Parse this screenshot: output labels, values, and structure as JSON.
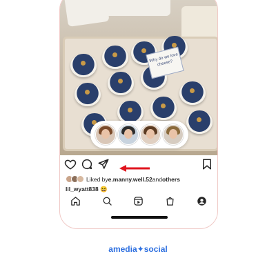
{
  "post": {
    "image_alt": "cheese display photo",
    "card_text": "Why do we love cheese?"
  },
  "share_sheet": {
    "friends": [
      {
        "name": "friend-1",
        "hair": "#7a4a2a",
        "bg": "#d9c7b8"
      },
      {
        "name": "friend-2",
        "hair": "#2c2c2c",
        "bg": "#c8d3de"
      },
      {
        "name": "friend-3",
        "hair": "#5b3b22",
        "bg": "#e0d0c2"
      },
      {
        "name": "friend-4",
        "hair": "#8a6a3b",
        "bg": "#d6ccc1"
      }
    ]
  },
  "actions": {
    "like_icon": "heart-icon",
    "comment_icon": "comment-icon",
    "share_icon": "send-icon",
    "save_icon": "bookmark-icon",
    "highlight_color": "#e0141e"
  },
  "likes": {
    "prefix": "Liked by ",
    "user": "e.manny.well.52",
    "middle": " and ",
    "others": "others"
  },
  "caption": {
    "username": "lil_wyatt838",
    "emoji": "😆"
  },
  "nav": {
    "items": [
      "home-icon",
      "search-icon",
      "reels-icon",
      "shop-icon",
      "profile-icon"
    ]
  },
  "brand": {
    "left": "amedia",
    "star": "✦",
    "right": "social",
    "color": "#2d6fe0"
  }
}
